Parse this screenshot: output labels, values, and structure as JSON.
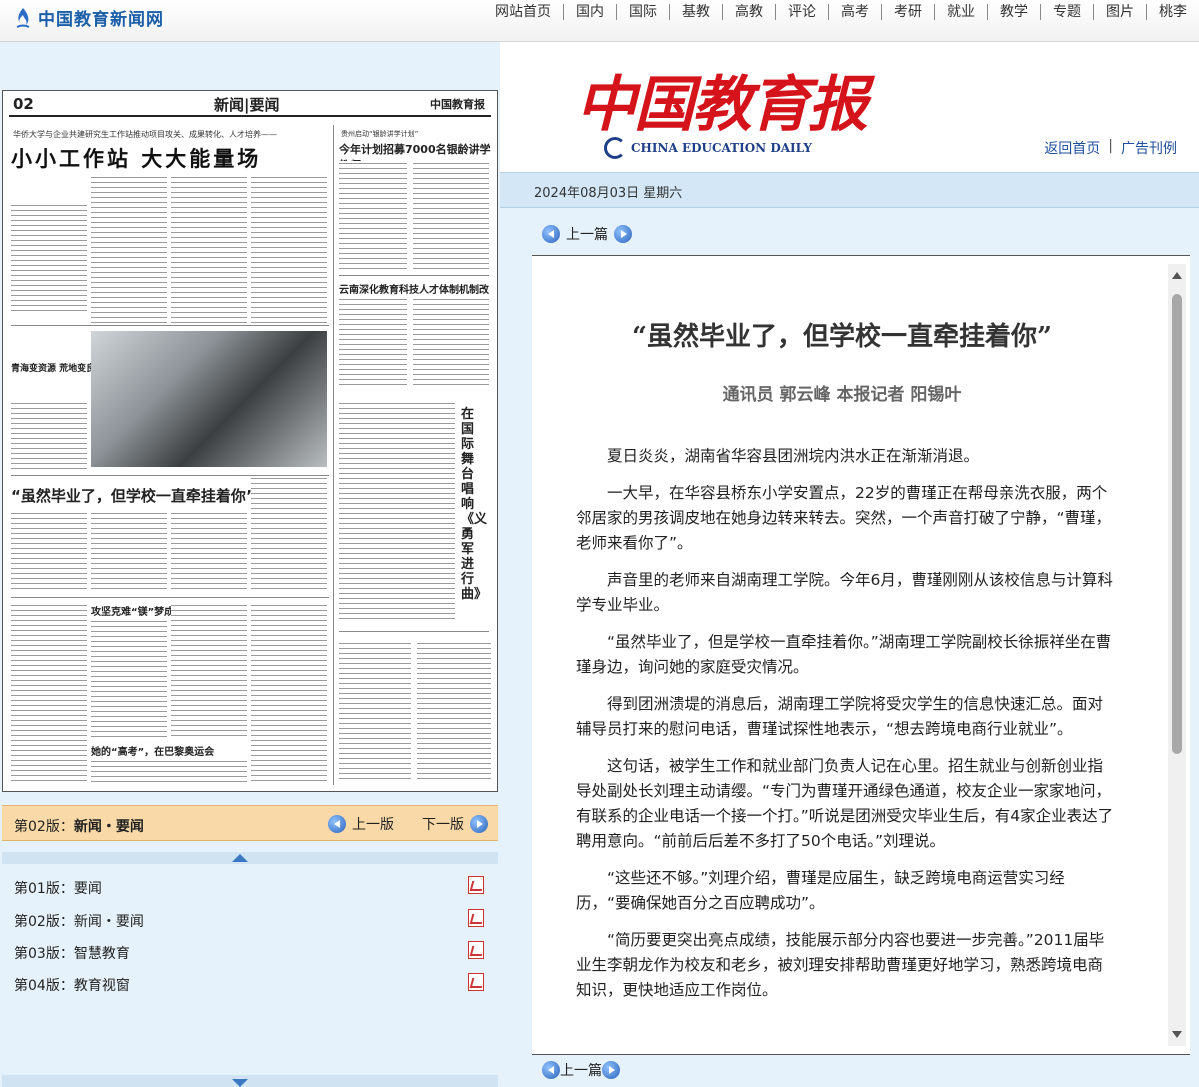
{
  "site": {
    "logo_text": "中国教育新闻网"
  },
  "nav": [
    "网站首页",
    "国内",
    "国际",
    "基教",
    "高教",
    "评论",
    "高考",
    "考研",
    "就业",
    "教学",
    "专题",
    "图片",
    "桃李"
  ],
  "newspaper_page": {
    "page_num": "02",
    "title": "新闻|要闻",
    "brand": "中国教育报",
    "kicker": "华侨大学与企业共建研究生工作站推动项目攻关、成果转化、人才培养——",
    "headline": "小小工作站 大大能量场",
    "head2_kicker": "贵州启动“银龄讲学计划”",
    "head2": "今年计划招募7000名银龄讲学教师",
    "head3": "云南深化教育科技人才体制机制改革",
    "side1": "青海变资源 荒地变良田",
    "head4": "“虽然毕业了，但学校一直牵挂着你”",
    "head5": "攻坚克难“镁”梦成真",
    "head6": "她的“高考”，在巴黎奥运会",
    "vertical": "在国际舞台唱响《义勇军进行曲》"
  },
  "page_bar": {
    "current_prefix": "第02版：",
    "current_name": "新闻・要闻",
    "prev": "上一版",
    "next": "下一版"
  },
  "editions": [
    {
      "label": "第01版：要闻"
    },
    {
      "label": "第02版：新闻・要闻"
    },
    {
      "label": "第03版：智慧教育"
    },
    {
      "label": "第04版：教育视窗"
    }
  ],
  "masthead": {
    "name_cn": "中国教育报",
    "name_en": "CHINA EDUCATION DAILY",
    "link_home": "返回首页",
    "link_ads": "广告刊例"
  },
  "date": "2024年08月03日 星期六",
  "article_nav": {
    "prev": "上一篇"
  },
  "article": {
    "title": "“虽然毕业了，但学校一直牵挂着你”",
    "author": "通讯员 郭云峰 本报记者 阳锡叶",
    "paragraphs": [
      "夏日炎炎，湖南省华容县团洲垸内洪水正在渐渐消退。",
      "一大早，在华容县桥东小学安置点，22岁的曹瑾正在帮母亲洗衣服，两个邻居家的男孩调皮地在她身边转来转去。突然，一个声音打破了宁静，“曹瑾，老师来看你了”。",
      "声音里的老师来自湖南理工学院。今年6月，曹瑾刚刚从该校信息与计算科学专业毕业。",
      "“虽然毕业了，但是学校一直牵挂着你。”湖南理工学院副校长徐振祥坐在曹瑾身边，询问她的家庭受灾情况。",
      "得到团洲溃堤的消息后，湖南理工学院将受灾学生的信息快速汇总。面对辅导员打来的慰问电话，曹瑾试探性地表示，“想去跨境电商行业就业”。",
      "这句话，被学生工作和就业部门负责人记在心里。招生就业与创新创业指导处副处长刘理主动请缨。“专门为曹瑾开通绿色通道，校友企业一家家地问，有联系的企业电话一个接一个打。”听说是团洲受灾毕业生后，有4家企业表达了聘用意向。“前前后后差不多打了50个电话。”刘理说。",
      "“这些还不够。”刘理介绍，曹瑾是应届生，缺乏跨境电商运营实习经历，“要确保她百分之百应聘成功”。",
      "“简历要更突出亮点成绩，技能展示部分内容也要进一步完善。”2011届毕业生李朝龙作为校友和老乡，被刘理安排帮助曹瑾更好地学习，熟悉跨境电商知识，更快地适应工作岗位。"
    ]
  },
  "bottom_nav": {
    "prev": "上一篇"
  }
}
